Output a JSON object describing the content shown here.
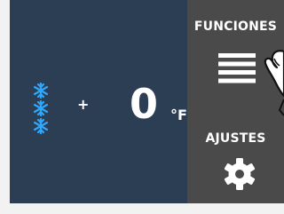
{
  "display": {
    "plus_sign": "+",
    "temperature_value": "0",
    "temperature_unit": "°F"
  },
  "side_menu": {
    "funciones_label": "FUNCIONES",
    "ajustes_label": "AJUSTES"
  },
  "icons": {
    "snowflake_count": 3,
    "mode_icon": "snowflake-icon",
    "menu_icon": "menu-lines-icon",
    "pointer_icon": "hand-pointer-icon",
    "settings_icon": "gear-icon"
  },
  "colors": {
    "main_panel": "#2c3e54",
    "side_panel": "#4a4a4a",
    "snowflake": "#2ea8ff",
    "text": "#ffffff"
  }
}
